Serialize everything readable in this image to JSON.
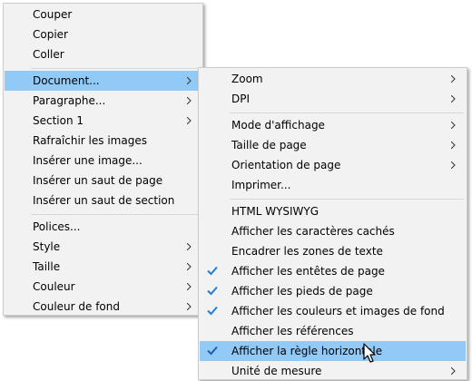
{
  "main_menu": {
    "cut": "Couper",
    "copy": "Copier",
    "paste": "Coller",
    "document": "Document...",
    "paragraph": "Paragraphe...",
    "section": "Section 1",
    "refresh_images": "Rafraîchir les images",
    "insert_image": "Insérer une image...",
    "insert_page_break": "Insérer un saut de page",
    "insert_section_break": "Insérer un saut de section",
    "fonts": "Polices...",
    "style": "Style",
    "size": "Taille",
    "color": "Couleur",
    "background_color": "Couleur de fond"
  },
  "document_menu": {
    "zoom": "Zoom",
    "dpi": "DPI",
    "view_mode": "Mode d'affichage",
    "page_size": "Taille de page",
    "page_orientation": "Orientation de page",
    "print": "Imprimer...",
    "html_wysiwyg": "HTML WYSIWYG",
    "show_hidden_chars": "Afficher les caractères cachés",
    "frame_text_zones": "Encadrer les zones de texte",
    "show_headers": "Afficher les entêtes de page",
    "show_footers": "Afficher les pieds de page",
    "show_colors_images": "Afficher les couleurs et images de fond",
    "show_references": "Afficher les références",
    "show_horizontal_ruler": "Afficher la règle horizontale",
    "unit": "Unité de mesure"
  },
  "checked": {
    "show_headers": true,
    "show_footers": true,
    "show_colors_images": true,
    "show_horizontal_ruler": true
  },
  "colors": {
    "highlight": "#91c9f7",
    "check": "#1f7fd9",
    "menu_bg": "#f2f2f2"
  }
}
